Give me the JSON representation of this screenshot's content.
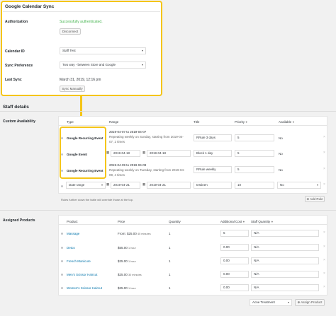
{
  "gcal": {
    "title": "Google Calendar Sync",
    "authorization_label": "Authorization",
    "auth_status": "Successfully authenticated.",
    "disconnect_label": "Disconnect",
    "calendar_id_label": "Calendar ID",
    "calendar_id_value": "Staff Test",
    "sync_pref_label": "Sync Preference",
    "sync_pref_value": "Two way - between Store and Google",
    "last_sync_label": "Last Sync",
    "last_sync_value": "March 31, 2019, 12:16 pm",
    "sync_manually_label": "Sync Manually"
  },
  "staff_details": {
    "title": "Staff details",
    "custom_availability_label": "Custom Availability",
    "headers": {
      "type": "Type",
      "range": "Range",
      "title": "Title",
      "priority": "Priority",
      "available": "Available"
    },
    "rows": [
      {
        "type": "Google Recurring Event",
        "range_line1": "2019-04-07 to 2019-04-07",
        "range_line2": "Repeating weekly on Sunday, starting from 2019-04-",
        "range_line3": "07, 2 times",
        "title": "RRule 3 days",
        "priority": "5",
        "available": "No"
      },
      {
        "type": "Google Event",
        "from": "2019-04-18",
        "to": "2019-04-18",
        "title": "Block 1 day",
        "priority": "5",
        "available": "No"
      },
      {
        "type": "Google Recurring Event",
        "range_line1": "2019-04-09 to 2019-04-09",
        "range_line2": "Repeating weekly on Tuesday, starting from 2019-04-",
        "range_line3": "09, 4 times",
        "title": "RRule weekly",
        "priority": "5",
        "available": "No"
      },
      {
        "type": "Date range",
        "from": "2019-04-21",
        "to": "2019-04-21",
        "title": "testinen",
        "priority": "10",
        "available": "No"
      }
    ],
    "rules_note": "Rules further down the table will override those at the top.",
    "add_rule_label": "Add Rule"
  },
  "assigned_products": {
    "label": "Assigned Products",
    "headers": {
      "product": "Product",
      "price": "Price",
      "quantity": "Quantity",
      "additional_cost": "Additional Cost",
      "staff_quantity": "Staff Quantity"
    },
    "rows": [
      {
        "product": "Massage",
        "price": "From: $25.00",
        "duration": "45 minutes",
        "quantity": "1",
        "additional_cost": "5",
        "staff_quantity": "N/A"
      },
      {
        "product": "Detox",
        "price": "$55.00",
        "duration": "1 hour",
        "quantity": "1",
        "additional_cost": "0.00",
        "staff_quantity": "N/A"
      },
      {
        "product": "French Manicure",
        "price": "$25.00",
        "duration": "1 hour",
        "quantity": "1",
        "additional_cost": "0.00",
        "staff_quantity": "N/A"
      },
      {
        "product": "Men's Scissor Haircut",
        "price": "$25.00",
        "duration": "30 minutes",
        "quantity": "1",
        "additional_cost": "0.00",
        "staff_quantity": "N/A"
      },
      {
        "product": "Women's Scissor Haircut",
        "price": "$25.00",
        "duration": "1 hour",
        "quantity": "1",
        "additional_cost": "0.00",
        "staff_quantity": "N/A"
      }
    ],
    "product_select": "Acne Treatment",
    "assign_label": "Assign Product"
  },
  "colors": {
    "highlight": "#f5c518",
    "link": "#0073aa",
    "success": "#46b450"
  },
  "icons": {
    "calendar": "calendar-icon",
    "remove": "close-icon",
    "drag": "drag-handle-icon",
    "help": "help-icon",
    "plus": "plus-icon"
  }
}
